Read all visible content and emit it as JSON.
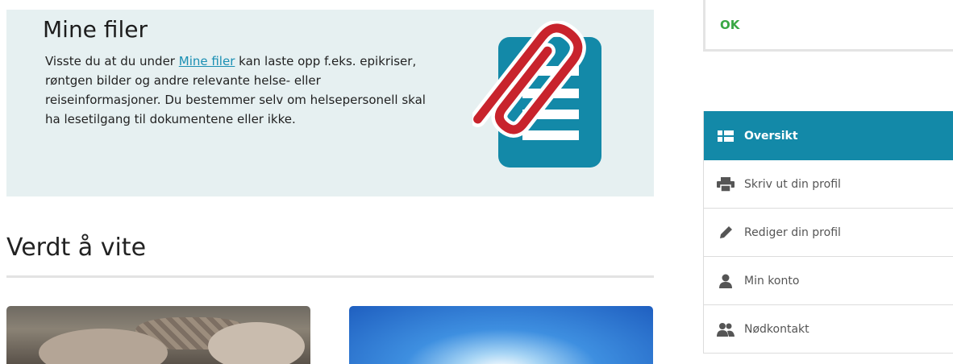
{
  "files_card": {
    "title": "Mine filer",
    "text_before_link": "Visste du at du under ",
    "link_label": "Mine filer",
    "text_after_link": " kan laste opp f.eks. epikriser, røntgen bilder og andre relevante helse- eller reiseinformasjoner. Du bestemmer selv om helsepersonell skal ha lesetilgang til dokumentene eller ikke.",
    "illustration_icon": "paperclip-document-icon"
  },
  "worth_knowing": {
    "title": "Verdt å vite"
  },
  "status": {
    "text": "OK",
    "color": "#3aa845"
  },
  "menu": {
    "accent_color": "#1389a8",
    "items": [
      {
        "label": "Oversikt",
        "icon": "grid-list-icon",
        "active": true
      },
      {
        "label": "Skriv ut din profil",
        "icon": "printer-icon",
        "active": false
      },
      {
        "label": "Rediger din profil",
        "icon": "pencil-icon",
        "active": false
      },
      {
        "label": "Min konto",
        "icon": "user-icon",
        "active": false
      },
      {
        "label": "Nødkontakt",
        "icon": "users-icon",
        "active": false
      }
    ]
  }
}
